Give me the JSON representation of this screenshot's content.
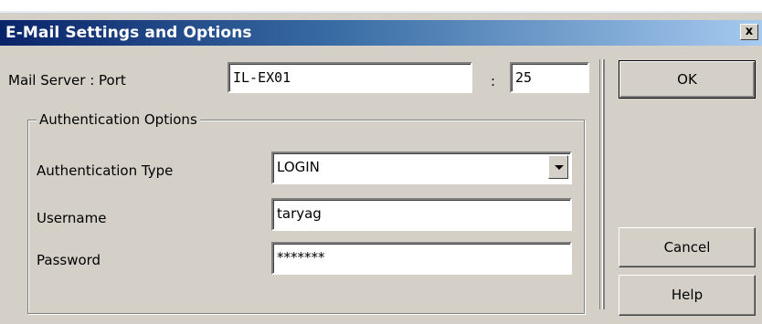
{
  "window": {
    "title": "E-Mail Settings and Options",
    "close_glyph": "x"
  },
  "mail_server": {
    "label": "Mail Server : Port",
    "server": "IL-EX01",
    "separator": ":",
    "port": "25"
  },
  "auth": {
    "group_label": "Authentication Options",
    "type_label": "Authentication Type",
    "type_value": "LOGIN",
    "username_label": "Username",
    "username_value": "taryag",
    "password_label": "Password",
    "password_value": "*******"
  },
  "buttons": {
    "ok": "OK",
    "cancel": "Cancel",
    "help": "Help"
  },
  "colors": {
    "title_start": "#0a246a",
    "title_end": "#a6caf0",
    "face": "#d4d0c8"
  },
  "icons": {
    "close": "close-icon",
    "dropdown": "chevron-down-icon"
  }
}
